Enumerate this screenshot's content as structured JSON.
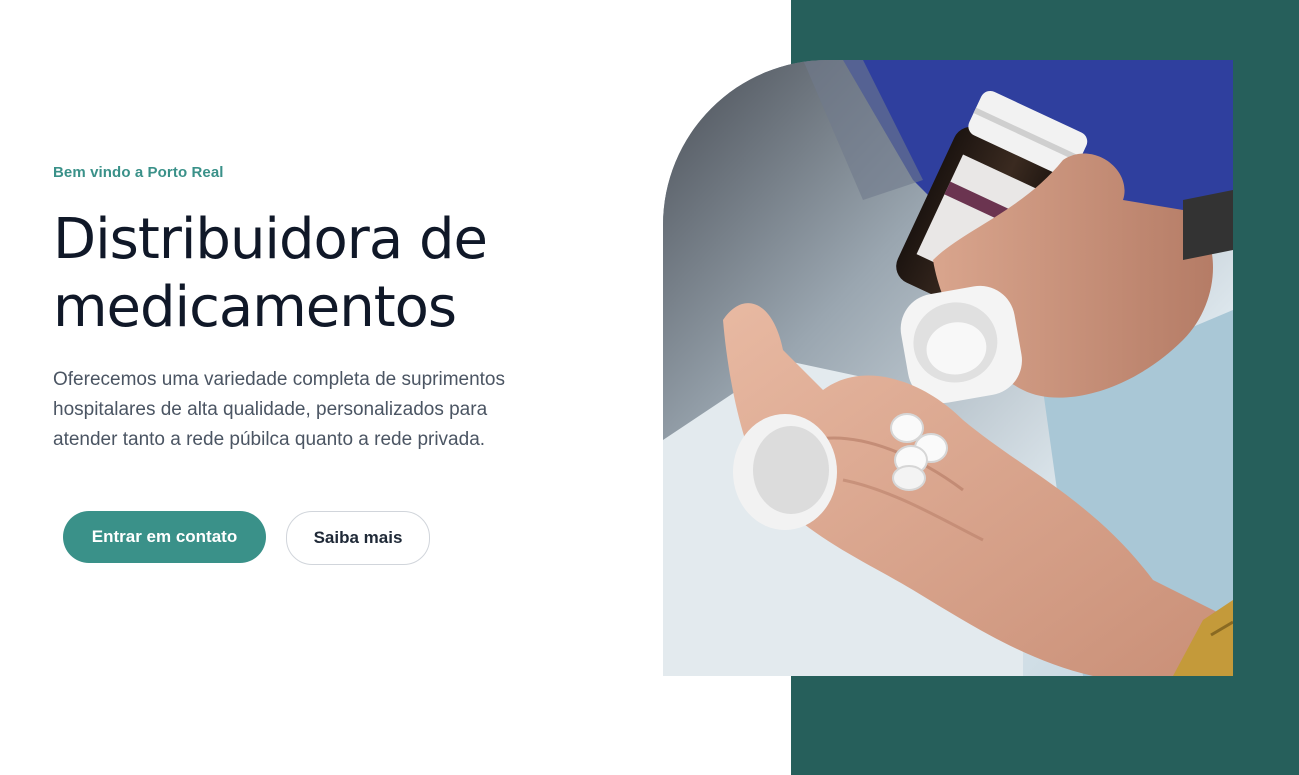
{
  "hero": {
    "eyebrow": "Bem vindo a Porto Real",
    "headline_line1": "Distribuidora de",
    "headline_line2": "medicamentos",
    "description": "Oferecemos uma variedade completa de suprimentos hospitalares de alta qualidade, personalizados para atender tanto a rede púbilca quanto a rede privada.",
    "primary_button": "Entrar em contato",
    "secondary_button": "Saiba mais"
  },
  "colors": {
    "accent": "#3a9189",
    "panel": "#265f5b",
    "heading": "#101828",
    "body_text": "#4b5563"
  },
  "image": {
    "subject": "hands-holding-pills-and-medicine-bottle"
  }
}
